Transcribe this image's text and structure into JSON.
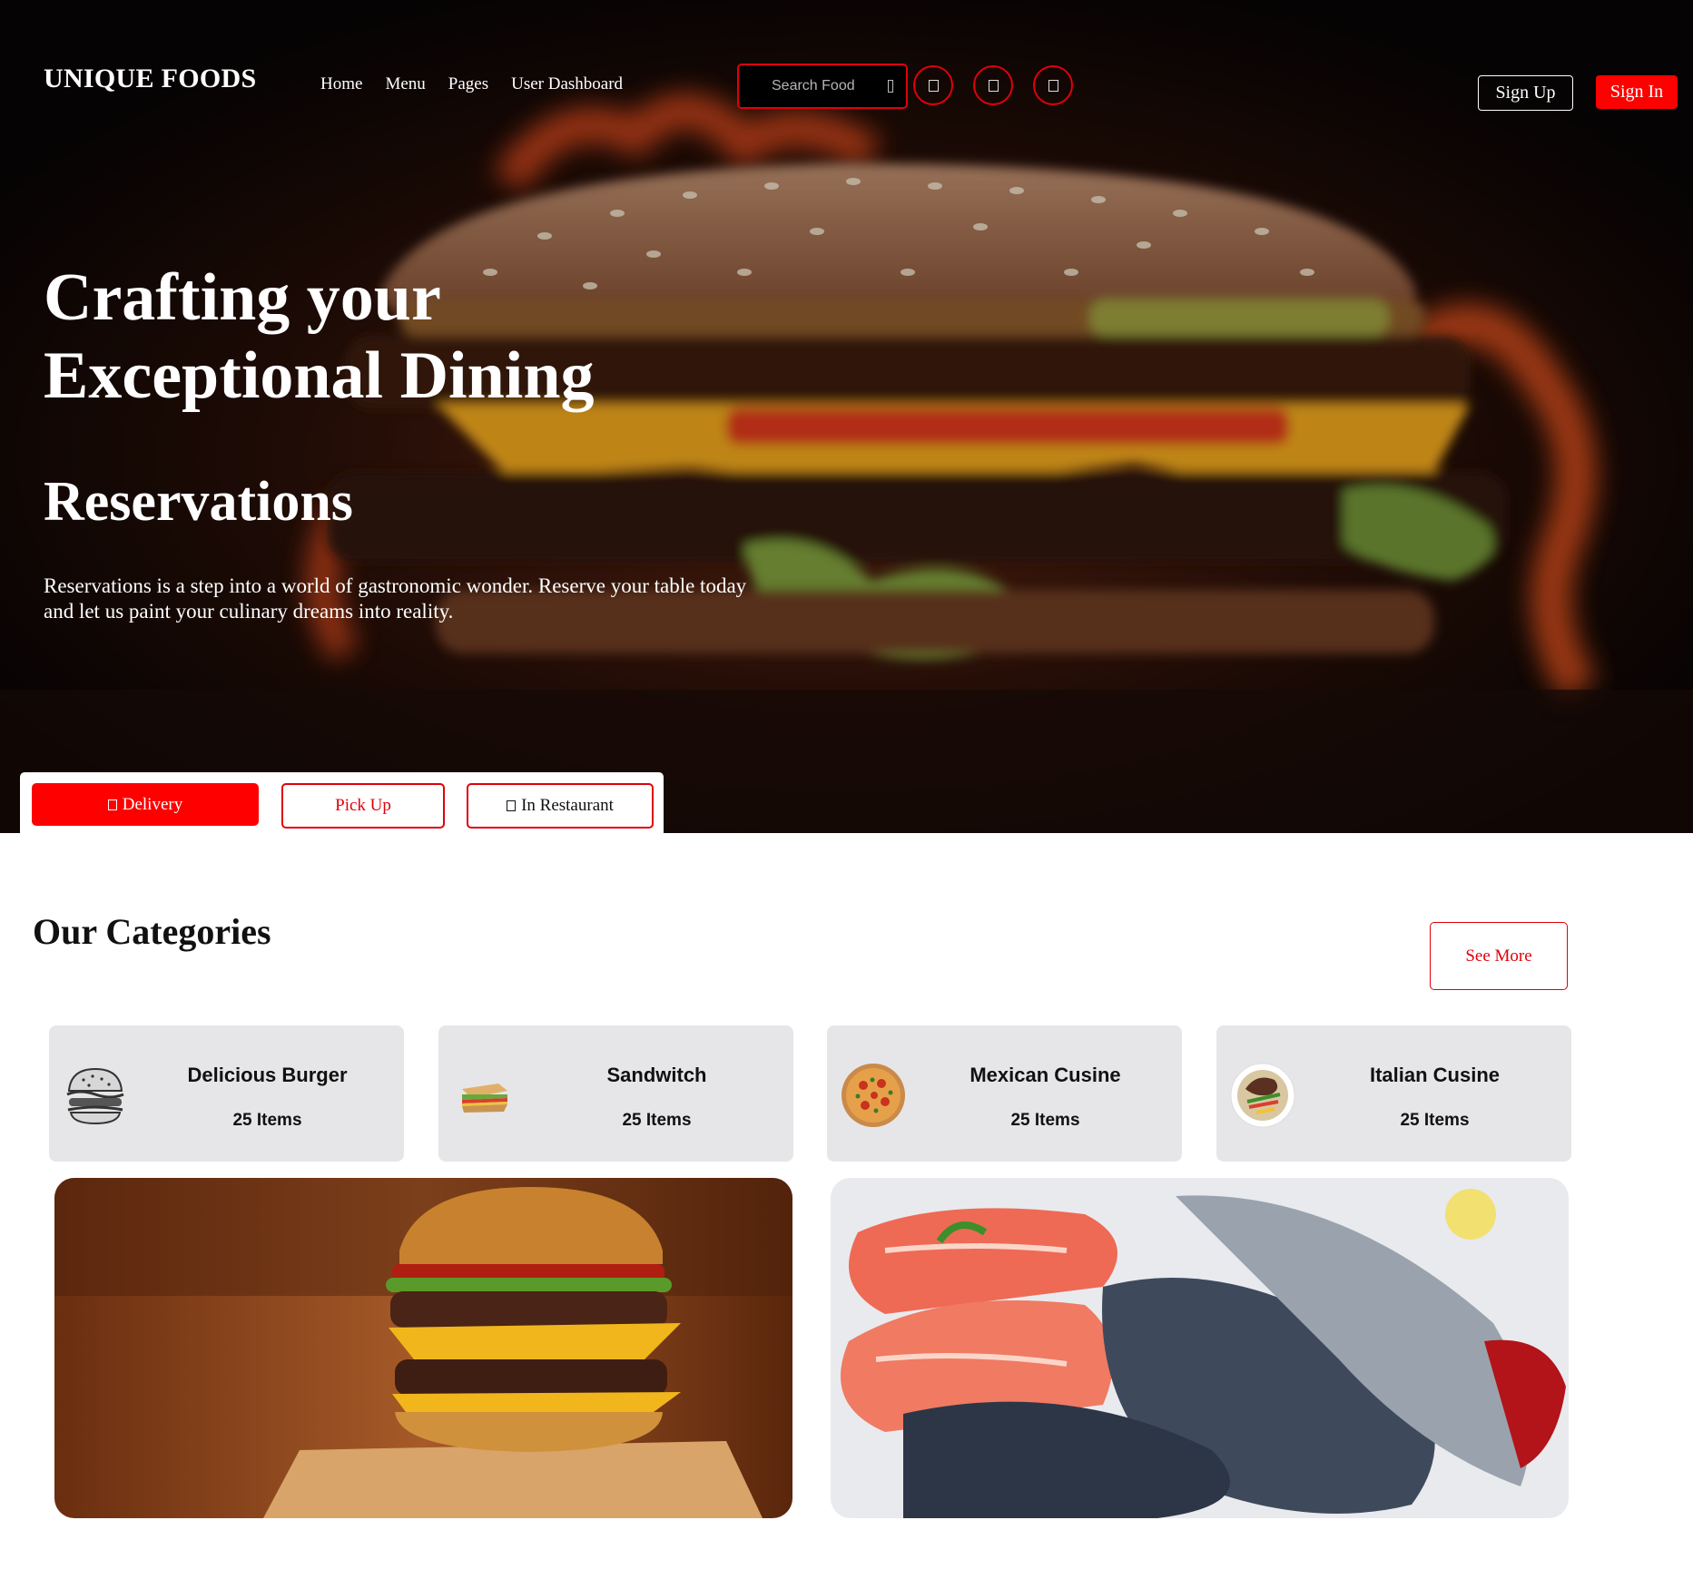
{
  "brand": {
    "name": "UNIQUE FOODS"
  },
  "nav": {
    "items": [
      "Home",
      "Menu",
      "Pages",
      "User Dashboard"
    ]
  },
  "search": {
    "placeholder": "Search Food",
    "icon": "search-icon"
  },
  "header_icons": [
    "heart-icon",
    "cart-icon",
    "user-icon"
  ],
  "auth": {
    "sign_up": "Sign Up",
    "sign_in": "Sign In"
  },
  "hero": {
    "title": "Crafting your Exceptional Dining",
    "subtitle": "Reservations",
    "description": "Reservations is a step into a world of gastronomic wonder. Reserve your table today and let us paint your culinary dreams into reality."
  },
  "order_modes": [
    {
      "label": "Delivery",
      "icon": "truck-icon",
      "active": true
    },
    {
      "label": "Pick Up",
      "active": false
    },
    {
      "label": "In Restaurant",
      "icon": "utensils-icon",
      "active": false
    }
  ],
  "categories": {
    "title": "Our Categories",
    "see_more": "See More",
    "items": [
      {
        "name": "Delicious Burger",
        "count": "25 Items"
      },
      {
        "name": "Sandwitch",
        "count": "25 Items"
      },
      {
        "name": "Mexican Cusine",
        "count": "25 Items"
      },
      {
        "name": "Italian Cusine",
        "count": "25 Items"
      }
    ]
  },
  "colors": {
    "accent": "#ff0000",
    "accent_border": "#e0000a",
    "card_bg": "#e6e6e8",
    "hero_bg": "#0b0605"
  }
}
